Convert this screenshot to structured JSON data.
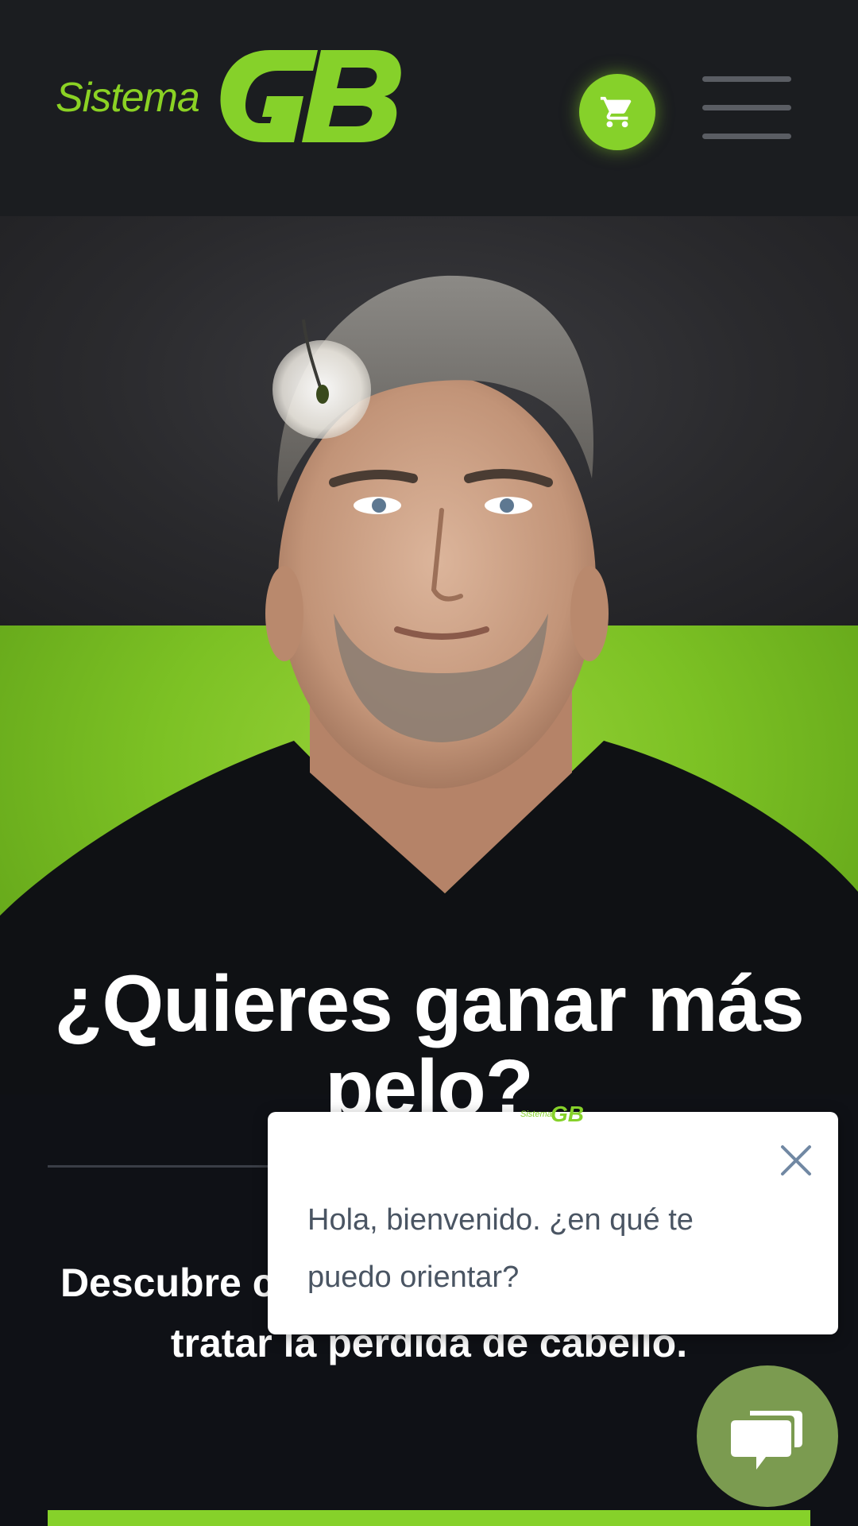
{
  "brand": {
    "logo_word": "Sistema",
    "logo_mark": "GB",
    "accent_color": "#86d12a",
    "header_bg": "#1b1d20",
    "page_bg": "#0f1116"
  },
  "header": {
    "cart_icon": "shopping-cart-icon",
    "menu_icon": "hamburger-menu-icon"
  },
  "hero": {
    "image": "man-portrait-hair-follicle",
    "headline": "¿Quieres ganar más pelo?",
    "subtext": "Descubre cómo Sistema GB te ayuda a tratar la pérdida de cabello."
  },
  "chat": {
    "greeting": "Hola, bienvenido. ¿en qué te puedo orientar?",
    "avatar_word": "Sistema",
    "avatar_mark": "GB",
    "close_icon": "close-icon",
    "launcher_icon": "chat-bubble-icon",
    "launcher_color": "#7b9b50"
  }
}
